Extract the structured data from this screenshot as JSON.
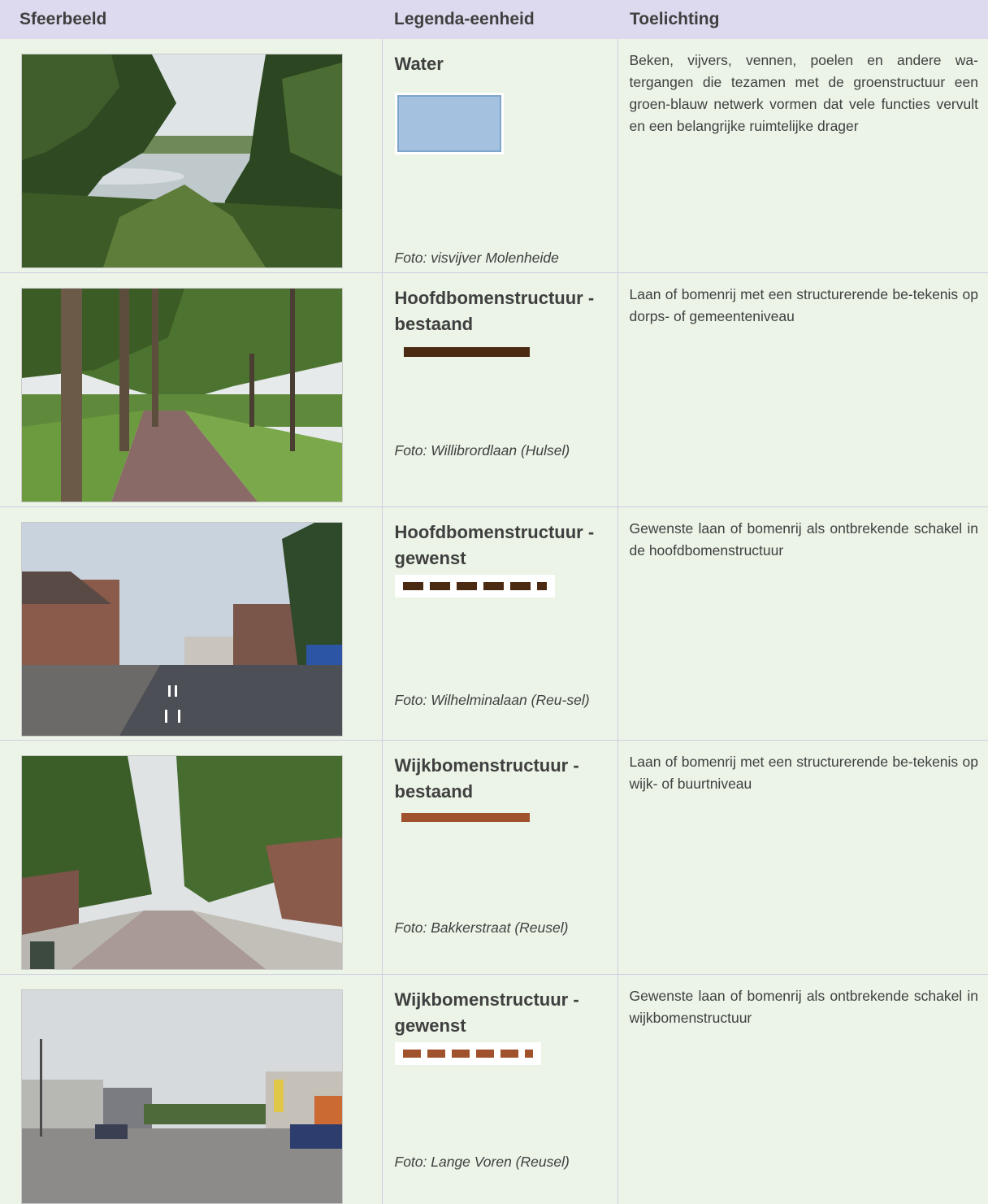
{
  "table": {
    "headers": [
      "Sfeerbeeld",
      "Legenda-eenheid",
      "Toelichting"
    ],
    "rows": [
      {
        "title": "Water",
        "caption": "Foto: visvijver Molenheide (Reusel)",
        "description": "Beken, vijvers, vennen, poelen en andere wa-tergangen die tezamen met de groenstructuur een groen-blauw netwerk vormen dat vele functies vervult en een belangrijke ruimtelijke drager",
        "legend_symbol": "light-blue-filled-rectangle",
        "legend_color": "#a4c1e0",
        "photo": "pond-landscape"
      },
      {
        "title": "Hoofdbomenstructuur - bestaand",
        "caption": "Foto: Willibrordlaan (Hulsel)",
        "description": "Laan of bomenrij met een structurerende be-tekenis op dorps- of gemeenteniveau",
        "legend_symbol": "solid-line",
        "legend_color": "#4b2a14",
        "photo": "tree-lined-brick-road"
      },
      {
        "title": "Hoofdbomenstructuur - gewenst",
        "caption": "Foto: Wilhelminalaan (Reu-sel)",
        "description": "Gewenste laan of bomenrij als ontbrekende schakel in de hoofdbomenstructuur",
        "legend_symbol": "dashed-line",
        "legend_color": "#4b2a14",
        "photo": "village-street"
      },
      {
        "title": "Wijkbomenstructuur - bestaand",
        "caption": "Foto: Bakkerstraat (Reusel)",
        "description": "Laan of bomenrij met een structurerende be-tekenis op wijk- of buurtniveau",
        "legend_symbol": "solid-line",
        "legend_color": "#a0522d",
        "photo": "poplar-lined-street"
      },
      {
        "title": "Wijkbomenstructuur - gewenst",
        "caption": "Foto: Lange Voren (Reusel)",
        "description": "Gewenste laan of bomenrij als ontbrekende schakel in wijkbomenstructuur",
        "legend_symbol": "dashed-line",
        "legend_color": "#a0522d",
        "photo": "industrial-street"
      }
    ]
  },
  "colors": {
    "header_bg": "#ddd9ee",
    "row_bg": "#ebf4e7",
    "border": "#cfcce4"
  }
}
